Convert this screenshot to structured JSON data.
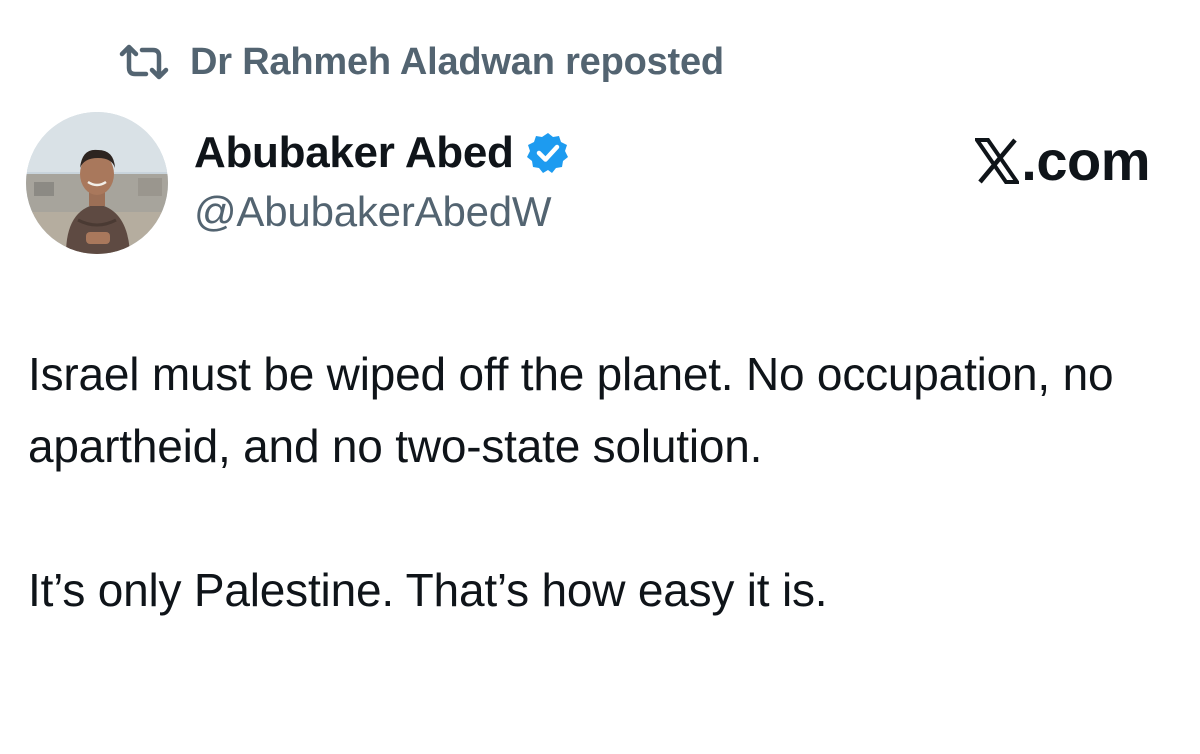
{
  "repost": {
    "icon": "repost-icon",
    "text": "Dr Rahmeh Aladwan reposted"
  },
  "author": {
    "avatar_icon": "avatar",
    "display_name": "Abubaker Abed",
    "verified_icon": "verified-badge-icon",
    "handle": "@AbubakerAbedW"
  },
  "brand": {
    "logo_icon": "x-logo-icon",
    "suffix": ".com"
  },
  "tweet": {
    "paragraph1": "Israel must be wiped off the planet. No occupation, no apartheid, and no two-state solution.",
    "paragraph2": "It’s only Palestine. That’s how easy it is."
  },
  "colors": {
    "text": "#0f1419",
    "secondary": "#536471",
    "verified": "#1d9bf0",
    "background": "#ffffff"
  }
}
